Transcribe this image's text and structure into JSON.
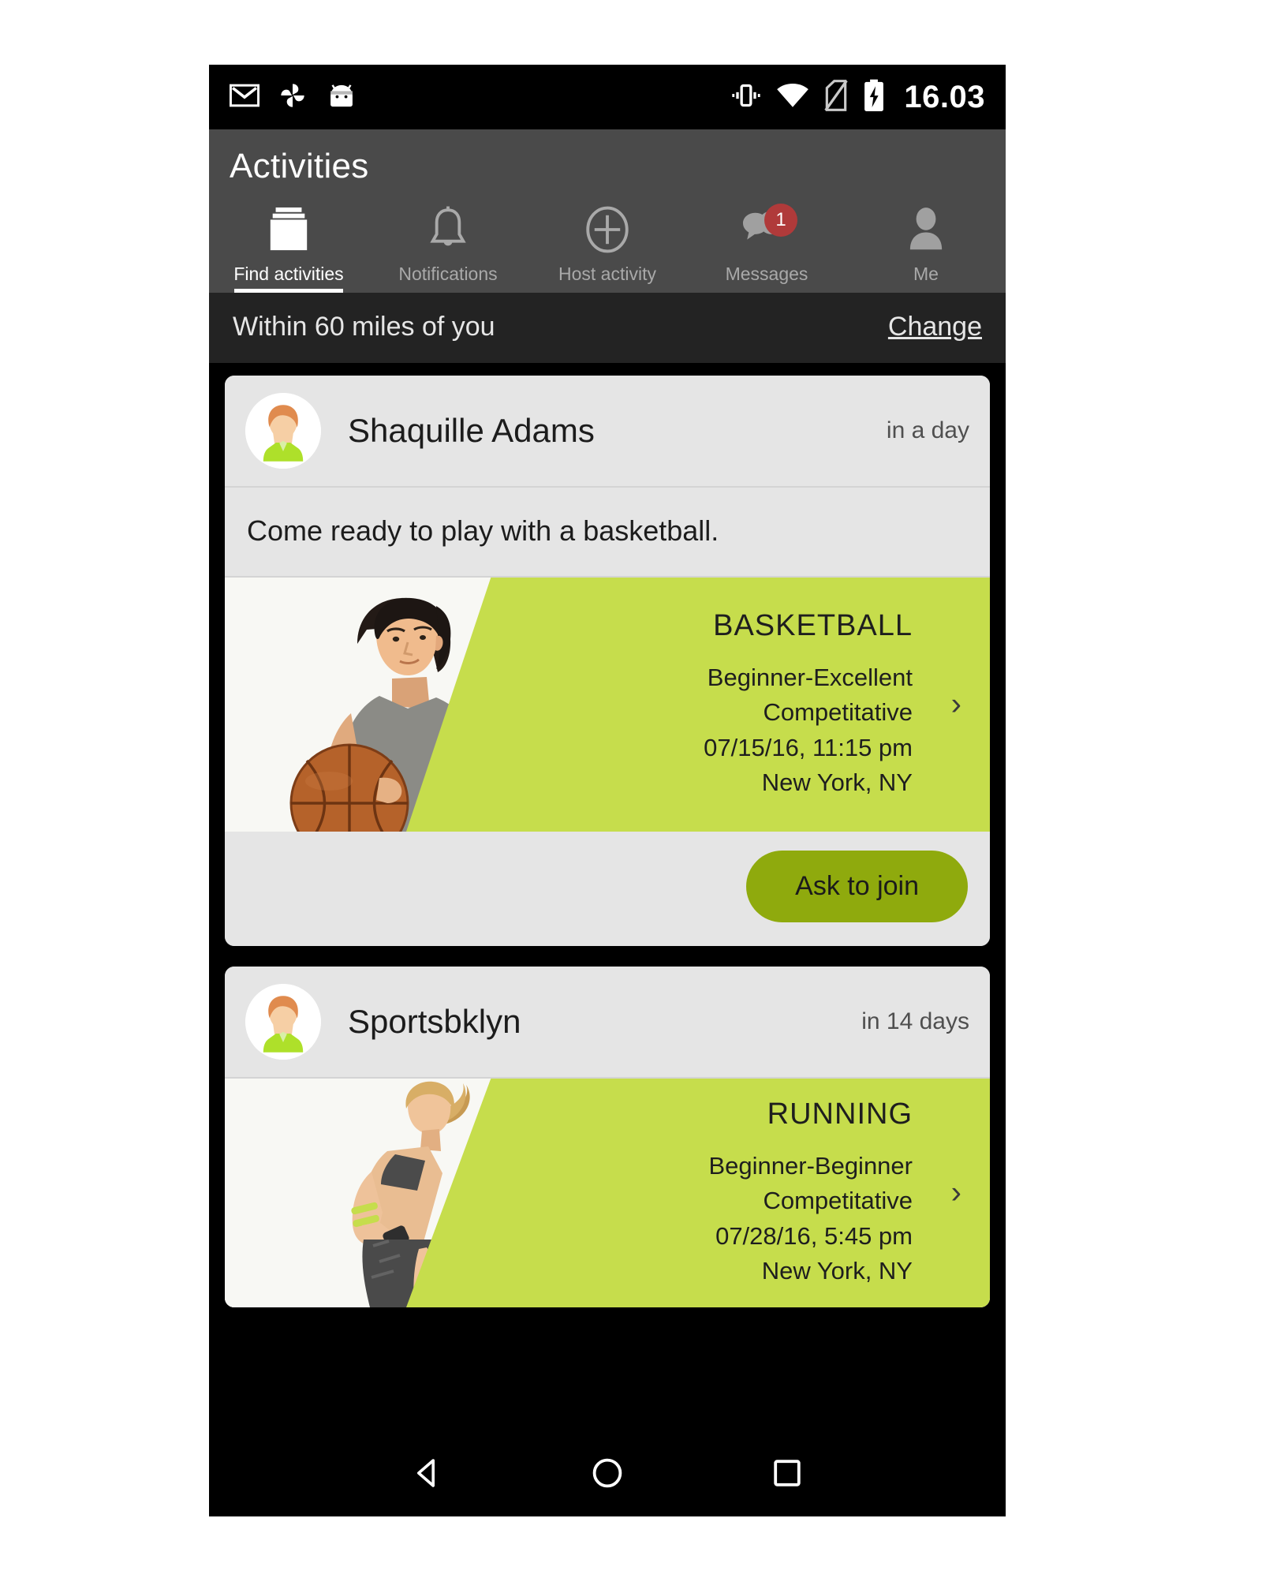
{
  "status_bar": {
    "time": "16.03",
    "left_icons": [
      "gmail-icon",
      "photos-pinwheel-icon",
      "android-head-icon"
    ],
    "right_icons": [
      "vibrate-icon",
      "wifi-icon",
      "no-sim-icon",
      "battery-charging-icon"
    ]
  },
  "header": {
    "title": "Activities",
    "background": "#4a4a4a"
  },
  "tabs": [
    {
      "label": "Find activities",
      "icon": "cards-stack-icon",
      "active": true,
      "badge": ""
    },
    {
      "label": "Notifications",
      "icon": "bell-icon",
      "active": false,
      "badge": ""
    },
    {
      "label": "Host activity",
      "icon": "plus-circle-icon",
      "active": false,
      "badge": ""
    },
    {
      "label": "Messages",
      "icon": "chat-bubbles-icon",
      "active": false,
      "badge": "1"
    },
    {
      "label": "Me",
      "icon": "person-icon",
      "active": false,
      "badge": ""
    }
  ],
  "filter_bar": {
    "text": "Within 60 miles of you",
    "change_label": "Change"
  },
  "colors": {
    "lime": "#c6dd4c",
    "olive_button": "#8faa0d",
    "badge_red": "#b03a3a",
    "card_bg": "#e5e5e5",
    "header_gray": "#4a4a4a",
    "filter_bar_bg": "#232323"
  },
  "cards": [
    {
      "host": "Shaquille Adams",
      "when": "in a day",
      "description": "Come ready to play with a basketball.",
      "sport": "BASKETBALL",
      "skill": "Beginner-Excellent",
      "mode": "Competitative",
      "datetime": "07/15/16, 11:15 pm",
      "location": "New York, NY",
      "photo": "male-basketball-player-photo",
      "chevron": "›",
      "join_label": "Ask to join"
    },
    {
      "host": "Sportsbklyn",
      "when": "in 14 days",
      "description": "",
      "sport": "RUNNING",
      "skill": "Beginner-Beginner",
      "mode": "Competitative",
      "datetime": "07/28/16, 5:45 pm",
      "location": "New York, NY",
      "photo": "female-runner-photo",
      "chevron": "›",
      "join_label": ""
    }
  ],
  "nav_bar": {
    "back": "back-triangle-icon",
    "home": "home-circle-icon",
    "recents": "recents-square-icon"
  }
}
